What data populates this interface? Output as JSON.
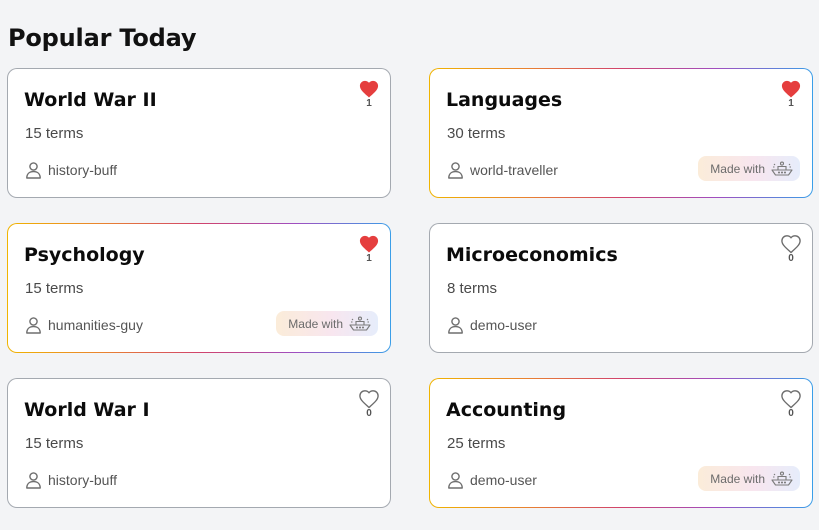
{
  "section": {
    "title": "Popular Today"
  },
  "cards": [
    {
      "title": "World War II",
      "terms": "15 terms",
      "user": "history-buff",
      "likes": "1",
      "liked": true,
      "made_with": null,
      "heart_icon": "heart-filled-icon"
    },
    {
      "title": "Languages",
      "terms": "30 terms",
      "user": "world-traveller",
      "likes": "1",
      "liked": true,
      "made_with": "Made with",
      "heart_icon": "heart-filled-icon"
    },
    {
      "title": "Psychology",
      "terms": "15 terms",
      "user": "humanities-guy",
      "likes": "1",
      "liked": true,
      "made_with": "Made with",
      "heart_icon": "heart-filled-icon"
    },
    {
      "title": "Microeconomics",
      "terms": "8 terms",
      "user": "demo-user",
      "likes": "0",
      "liked": false,
      "made_with": null,
      "heart_icon": "heart-outline-icon"
    },
    {
      "title": "World War I",
      "terms": "15 terms",
      "user": "history-buff",
      "likes": "0",
      "liked": false,
      "made_with": null,
      "heart_icon": "heart-outline-icon"
    },
    {
      "title": "Accounting",
      "terms": "25 terms",
      "user": "demo-user",
      "likes": "0",
      "liked": false,
      "made_with": "Made with",
      "heart_icon": "heart-outline-icon"
    }
  ],
  "colors": {
    "heart_filled": "#e53e3e",
    "heart_outline": "#6b6b6b",
    "card_border": "#a4a9b0",
    "gradient_border": [
      "#f0b400",
      "#e98330",
      "#d1436c",
      "#a04ec0",
      "#3a9ee8"
    ]
  }
}
